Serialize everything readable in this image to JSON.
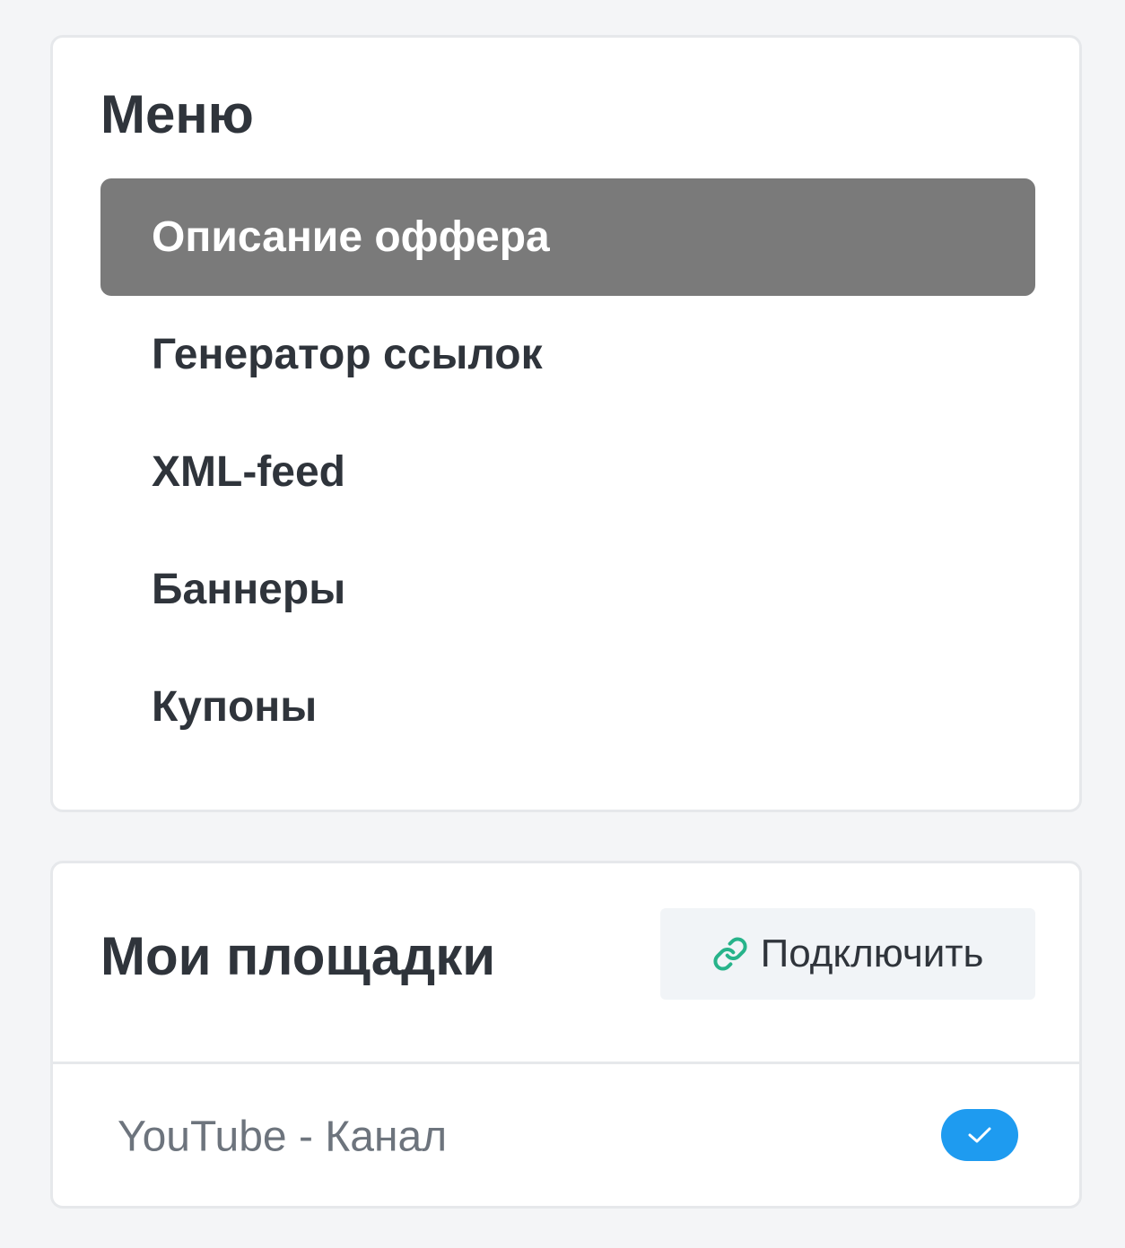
{
  "menu": {
    "title": "Меню",
    "items": [
      {
        "label": "Описание оффера",
        "active": true
      },
      {
        "label": "Генератор ссылок",
        "active": false
      },
      {
        "label": "XML-feed",
        "active": false
      },
      {
        "label": "Баннеры",
        "active": false
      },
      {
        "label": "Купоны",
        "active": false
      }
    ]
  },
  "sites": {
    "title": "Мои площадки",
    "connect_label": "Подключить",
    "connect_icon": "link-icon",
    "list": [
      {
        "name": "YouTube - Канал",
        "checked": true
      }
    ]
  },
  "colors": {
    "active_item_bg": "#7a7a7a",
    "check_blue": "#1e9bf0",
    "link_icon_green": "#27b38a",
    "text_dark": "#2f343b",
    "text_muted": "#6d747d"
  }
}
